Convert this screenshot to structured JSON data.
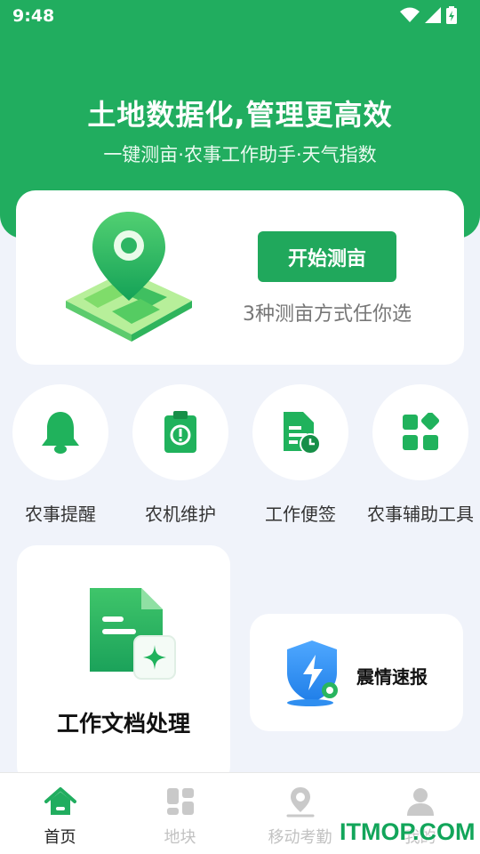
{
  "status_bar": {
    "time": "9:48"
  },
  "hero": {
    "title": "土地数据化,管理更高效",
    "subtitle": "一键测亩·农事工作助手·天气指数"
  },
  "main_card": {
    "button_label": "开始测亩",
    "subtitle": "3种测亩方式任你选"
  },
  "quick_actions": [
    {
      "label": "农事提醒",
      "icon": "bell-icon"
    },
    {
      "label": "农机维护",
      "icon": "clipboard-alert-icon"
    },
    {
      "label": "工作便签",
      "icon": "note-clock-icon"
    },
    {
      "label": "农事辅助工具",
      "icon": "apps-grid-icon"
    }
  ],
  "doc_card": {
    "title": "工作文档处理"
  },
  "quake_card": {
    "title": "震情速报"
  },
  "bottom_nav": [
    {
      "label": "首页",
      "icon": "home-icon",
      "active": true
    },
    {
      "label": "地块",
      "icon": "blocks-icon",
      "active": false
    },
    {
      "label": "移动考勤",
      "icon": "location-pin-icon",
      "active": false
    },
    {
      "label": "我的",
      "icon": "person-icon",
      "active": false
    }
  ],
  "watermark": "ITMOP.COM",
  "colors": {
    "brand_green": "#21ad5f",
    "background": "#f0f3fa",
    "inactive_nav": "#c2c2c2"
  }
}
